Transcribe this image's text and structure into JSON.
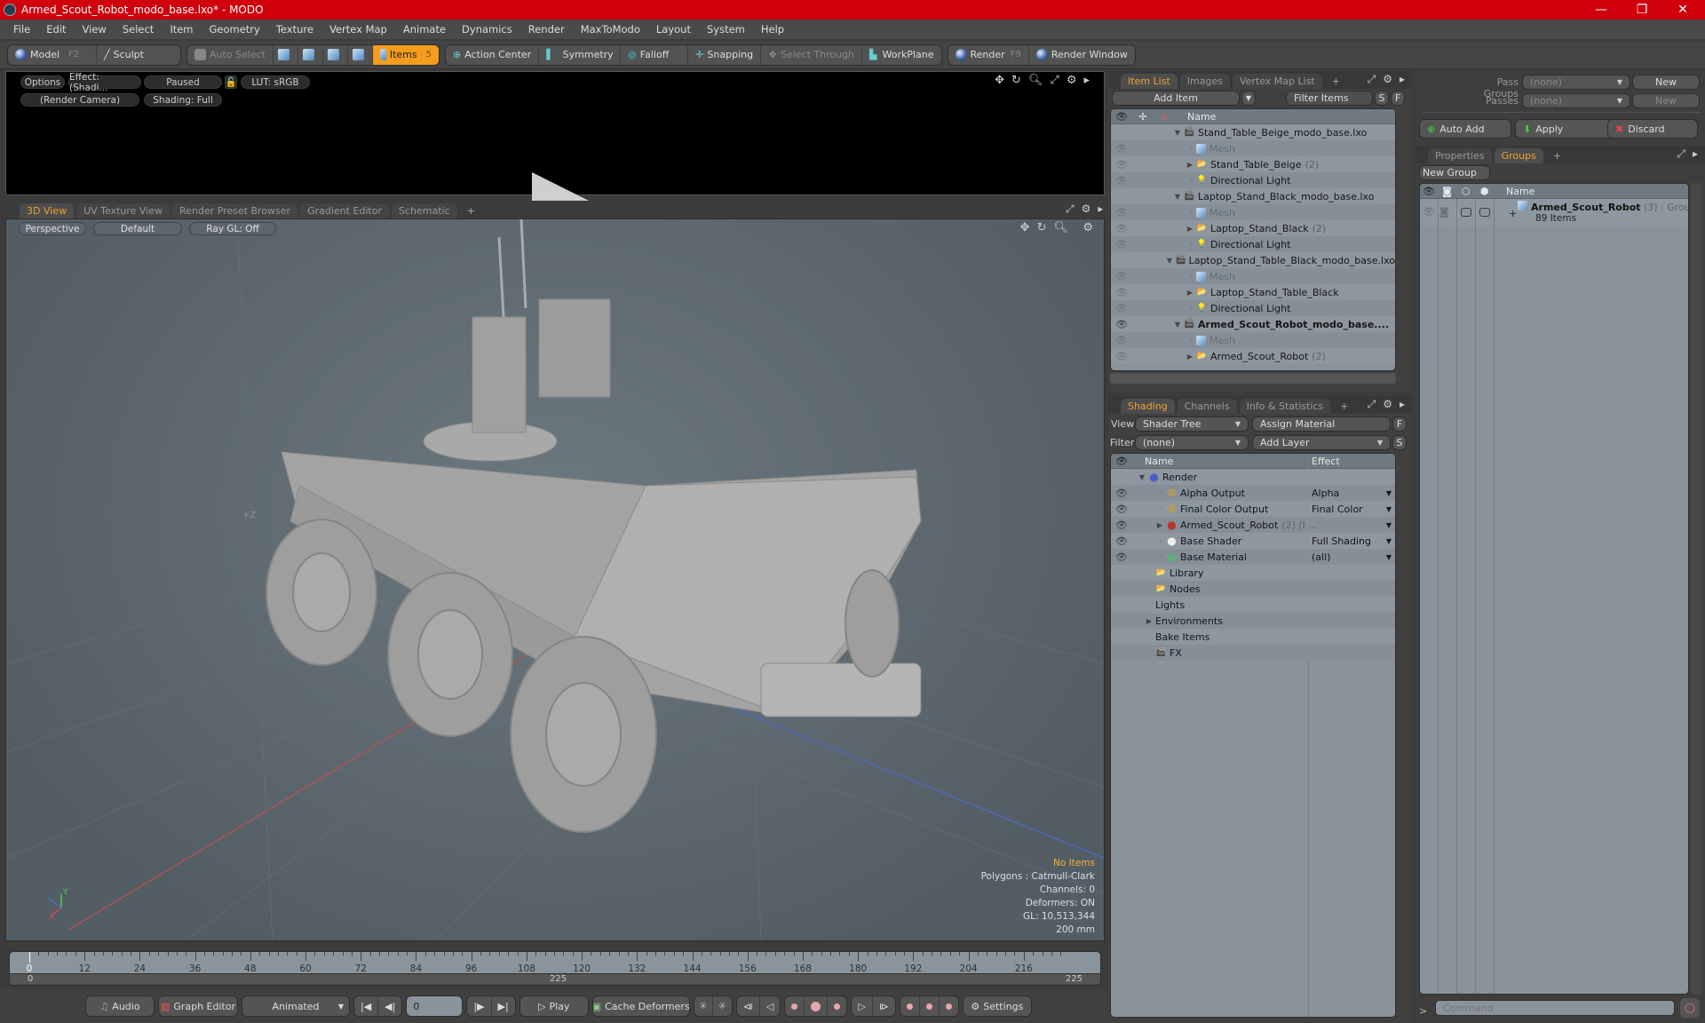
{
  "window": {
    "title": "Armed_Scout_Robot_modo_base.lxo* - MODO",
    "controls": {
      "minimize": "—",
      "restore": "❐",
      "close": "✕"
    }
  },
  "menu": [
    "File",
    "Edit",
    "View",
    "Select",
    "Item",
    "Geometry",
    "Texture",
    "Vertex Map",
    "Animate",
    "Dynamics",
    "Render",
    "MaxToModo",
    "Layout",
    "System",
    "Help"
  ],
  "toolbar": {
    "model": "Model",
    "model_key": "F2",
    "sculpt": "Sculpt",
    "auto_select": "Auto Select",
    "items": "Items",
    "items_key": "5",
    "action_center": "Action Center",
    "symmetry": "Symmetry",
    "falloff": "Falloff",
    "snapping": "Snapping",
    "select_through": "Select Through",
    "workplane": "WorkPlane",
    "render": "Render",
    "render_key": "F9",
    "render_window": "Render Window"
  },
  "preview": {
    "options": "Options",
    "effect": "Effect: (Shadi...",
    "paused": "Paused",
    "lut": "LUT: sRGB",
    "camera": "(Render Camera)",
    "shading": "Shading: Full"
  },
  "viewport": {
    "tabs": [
      "3D View",
      "UV Texture View",
      "Render Preset Browser",
      "Gradient Editor",
      "Schematic"
    ],
    "active_tab": "3D View",
    "perspective": "Perspective",
    "style": "Default",
    "raygl": "Ray GL: Off",
    "axis_label": "+Z",
    "info": {
      "selection": "No Items",
      "polygons": "Polygons : Catmull-Clark",
      "channels": "Channels: 0",
      "deformers": "Deformers: ON",
      "gl": "GL: 10,513,344",
      "scale": "200 mm"
    },
    "colors": {
      "x_axis": "#d04a4a",
      "y_axis": "#4ad04a",
      "z_axis": "#4a6ad0",
      "accent": "#f0a030"
    }
  },
  "timeline": {
    "labels": [
      "0",
      "12",
      "24",
      "36",
      "48",
      "60",
      "72",
      "84",
      "96",
      "108",
      "120",
      "132",
      "144",
      "156",
      "168",
      "180",
      "192",
      "204",
      "216"
    ],
    "range_start": "0",
    "range_mid": "225",
    "range_end": "225",
    "current_frame": 0,
    "max_frame": 225
  },
  "bottombar": {
    "audio": "Audio",
    "graph_editor": "Graph Editor",
    "animated": "Animated",
    "frame": "0",
    "play": "Play",
    "cache_deformers": "Cache Deformers",
    "settings": "Settings"
  },
  "itemlist": {
    "tabs": [
      "Item List",
      "Images",
      "Vertex Map List"
    ],
    "active_tab": "Item List",
    "add_item": "Add Item",
    "filter": "Filter Items",
    "s_btn": "S",
    "f_btn": "F",
    "col_name": "Name",
    "rows": [
      {
        "name": "Stand_Table_Beige_modo_base.lxo",
        "type": "scene",
        "indent": 0,
        "eye": false,
        "bold": false
      },
      {
        "name": "Mesh",
        "type": "mesh",
        "indent": 1,
        "eye": true,
        "muted": true
      },
      {
        "name": "Stand_Table_Beige",
        "count": "(2)",
        "type": "group",
        "indent": 1,
        "eye": true
      },
      {
        "name": "Directional Light",
        "type": "light",
        "indent": 1,
        "eye": true
      },
      {
        "name": "Laptop_Stand_Black_modo_base.lxo",
        "type": "scene",
        "indent": 0,
        "eye": false
      },
      {
        "name": "Mesh",
        "type": "mesh",
        "indent": 1,
        "eye": true,
        "muted": true
      },
      {
        "name": "Laptop_Stand_Black",
        "count": "(2)",
        "type": "group",
        "indent": 1,
        "eye": true
      },
      {
        "name": "Directional Light",
        "type": "light",
        "indent": 1,
        "eye": true
      },
      {
        "name": "Laptop_Stand_Table_Black_modo_base.lxo",
        "type": "scene",
        "indent": 0,
        "eye": false
      },
      {
        "name": "Mesh",
        "type": "mesh",
        "indent": 1,
        "eye": true,
        "muted": true
      },
      {
        "name": "Laptop_Stand_Table_Black",
        "type": "group",
        "indent": 1,
        "eye": true
      },
      {
        "name": "Directional Light",
        "type": "light",
        "indent": 1,
        "eye": true
      },
      {
        "name": "Armed_Scout_Robot_modo_base....",
        "type": "scene",
        "indent": 0,
        "eye": true,
        "bold": true
      },
      {
        "name": "Mesh",
        "type": "mesh",
        "indent": 1,
        "eye": true,
        "muted": true
      },
      {
        "name": "Armed_Scout_Robot",
        "count": "(2)",
        "type": "group",
        "indent": 1,
        "eye": true
      }
    ]
  },
  "shading": {
    "tabs": [
      "Shading",
      "Channels",
      "Info & Statistics"
    ],
    "active_tab": "Shading",
    "view_label": "View",
    "view_value": "Shader Tree",
    "assign_material": "Assign Material",
    "filter_label": "Filter",
    "filter_value": "(none)",
    "add_layer": "Add Layer",
    "f_btn": "F",
    "s_btn": "S",
    "col_name": "Name",
    "col_effect": "Effect",
    "rows": [
      {
        "name": "Render",
        "effect": "",
        "icon": "render",
        "indent": 0,
        "eye": false
      },
      {
        "name": "Alpha Output",
        "effect": "Alpha",
        "icon": "output",
        "indent": 1,
        "eye": true
      },
      {
        "name": "Final Color Output",
        "effect": "Final Color",
        "icon": "output",
        "indent": 1,
        "eye": true
      },
      {
        "name": "Armed_Scout_Robot",
        "count": "(2) (I ...",
        "effect": "",
        "icon": "material-group",
        "indent": 1,
        "eye": true,
        "expand": true
      },
      {
        "name": "Base Shader",
        "effect": "Full Shading",
        "icon": "shader",
        "indent": 1,
        "eye": true
      },
      {
        "name": "Base Material",
        "effect": "(all)",
        "icon": "material",
        "indent": 1,
        "eye": true
      },
      {
        "name": "Library",
        "effect": "",
        "icon": "folder",
        "indent": 0,
        "eye": false,
        "noeffect": true
      },
      {
        "name": "Nodes",
        "effect": "",
        "icon": "folder",
        "indent": 0,
        "eye": false,
        "noeffect": true
      },
      {
        "name": "Lights",
        "effect": "",
        "icon": "none",
        "indent": 0,
        "eye": false,
        "noeffect": true
      },
      {
        "name": "Environments",
        "effect": "",
        "icon": "none",
        "indent": 0,
        "eye": false,
        "noeffect": true,
        "expand": true
      },
      {
        "name": "Bake Items",
        "effect": "",
        "icon": "none",
        "indent": 0,
        "eye": false,
        "noeffect": true
      },
      {
        "name": "FX",
        "effect": "",
        "icon": "clap",
        "indent": 0,
        "eye": false,
        "noeffect": true
      }
    ]
  },
  "passes": {
    "pass_groups_label": "Pass Groups",
    "pass_groups_value": "(none)",
    "new1": "New",
    "passes_label": "Passes",
    "passes_value": "(none)",
    "new2": "New",
    "auto_add": "Auto Add",
    "apply": "Apply",
    "discard": "Discard"
  },
  "groups": {
    "tabs": [
      "Properties",
      "Groups"
    ],
    "active_tab": "Groups",
    "new_group": "New Group",
    "col_name": "Name",
    "item_name": "Armed_Scout_Robot",
    "item_count": "(3)",
    "item_type": ": Group",
    "item_sub": "89 Items"
  },
  "command": {
    "prompt": ">",
    "placeholder": "Command"
  }
}
